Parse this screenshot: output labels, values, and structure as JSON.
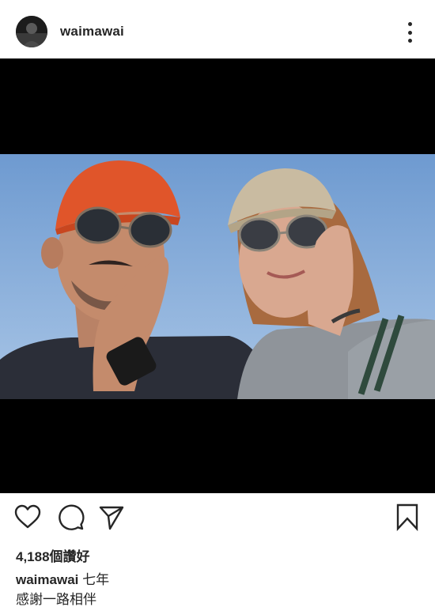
{
  "header": {
    "username": "waimawai",
    "avatar_icon": "profile-avatar",
    "more_icon": "more-options-icon"
  },
  "post": {
    "image_alt": "Selfie of a man in an orange cap and a woman in a beige cap, both wearing sunglasses, against a blue sky"
  },
  "actions": {
    "like_icon": "heart-icon",
    "comment_icon": "comment-icon",
    "share_icon": "send-icon",
    "save_icon": "bookmark-icon"
  },
  "likes": {
    "text": "4,188個讚好"
  },
  "caption": {
    "username": "waimawai",
    "text_line1": "七年",
    "text_line2": "感謝一路相伴"
  },
  "colors": {
    "text": "#262626",
    "background": "#ffffff",
    "letterbox": "#000000",
    "cap_orange": "#e0552a",
    "sky": "#8cb2dc"
  }
}
